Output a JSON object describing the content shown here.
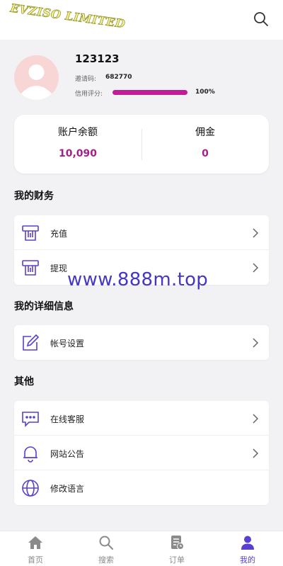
{
  "header": {
    "logo_text": "EVZISO LIMITED",
    "search_icon": "search-icon"
  },
  "profile": {
    "username": "123123",
    "invite_label": "邀请码:",
    "invite_code": "682770",
    "credit_label": "信用评分:",
    "credit_percent": 100,
    "credit_value": "100%"
  },
  "balance": {
    "account_label": "账户余额",
    "account_value": "10,090",
    "commission_label": "佣金",
    "commission_value": "0"
  },
  "sections": {
    "finance": {
      "title": "我的财务",
      "items": [
        {
          "label": "充值",
          "icon": "atm-card-icon"
        },
        {
          "label": "提现",
          "icon": "atm-card-icon"
        }
      ]
    },
    "details": {
      "title": "我的详细信息",
      "items": [
        {
          "label": "帐号设置",
          "icon": "edit-icon"
        }
      ]
    },
    "other": {
      "title": "其他",
      "items": [
        {
          "label": "在线客服",
          "icon": "chat-icon"
        },
        {
          "label": "网站公告",
          "icon": "bell-icon"
        },
        {
          "label": "修改语言",
          "icon": "globe-icon"
        }
      ]
    }
  },
  "watermark": "www.888m.top",
  "nav": [
    {
      "label": "首页",
      "icon": "home-icon"
    },
    {
      "label": "搜索",
      "icon": "search-icon"
    },
    {
      "label": "订单",
      "icon": "orders-icon"
    },
    {
      "label": "我的",
      "icon": "user-icon",
      "active": true
    }
  ],
  "colors": {
    "accent": "#c01e96",
    "value": "#a4208a",
    "icon": "#5a3fd0",
    "active_nav": "#5a3fd0"
  }
}
